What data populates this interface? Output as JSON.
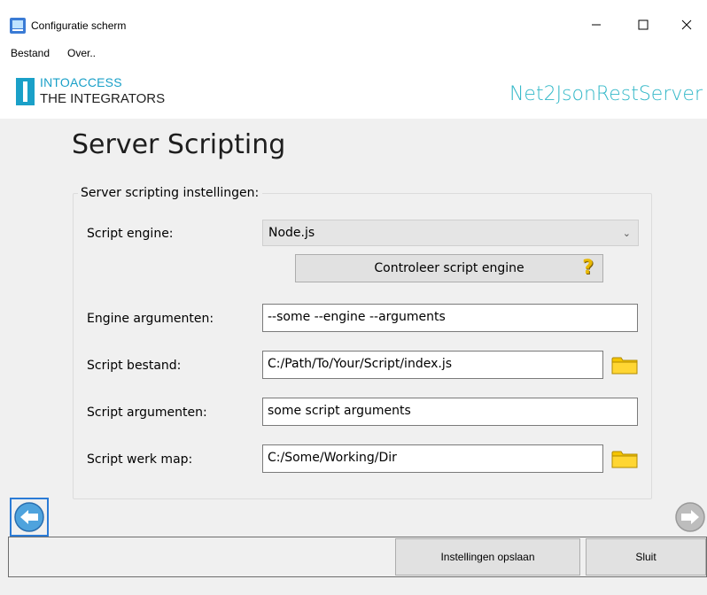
{
  "window": {
    "title": "Configuratie scherm",
    "controls": {
      "minimize": "minimize-icon",
      "maximize": "maximize-icon",
      "close": "close-icon"
    }
  },
  "menu": {
    "items": [
      "Bestand",
      "Over.."
    ]
  },
  "header": {
    "logo_line1": "INTOACCESS",
    "logo_line2": "THE INTEGRATORS",
    "brand": "Net2JsonRestServer",
    "colors": {
      "logo_accent": "#1aa0c8",
      "brand": "#33b8c8"
    }
  },
  "page": {
    "title": "Server Scripting",
    "group_legend": "Server scripting instellingen:"
  },
  "form": {
    "engine_label": "Script engine:",
    "engine_value": "Node.js",
    "check_button": "Controleer script engine",
    "engine_args_label": "Engine argumenten:",
    "engine_args_value": "--some --engine --arguments",
    "script_file_label": "Script bestand:",
    "script_file_value": "C:/Path/To/Your/Script/index.js",
    "script_args_label": "Script argumenten:",
    "script_args_value": "some script arguments",
    "work_dir_label": "Script werk map:",
    "work_dir_value": "C:/Some/Working/Dir"
  },
  "footer": {
    "save_button": "Instellingen opslaan",
    "close_button": "Sluit"
  }
}
